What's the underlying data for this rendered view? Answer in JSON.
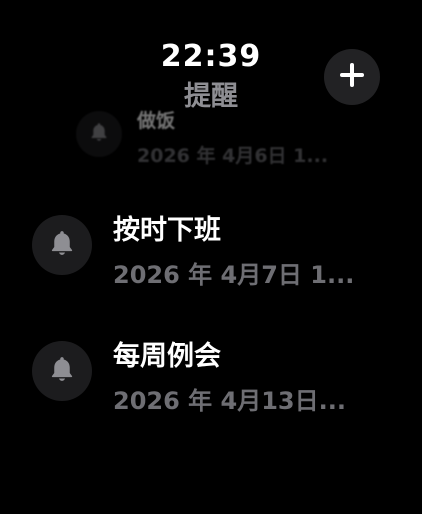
{
  "header": {
    "time": "22:39",
    "title": "提醒"
  },
  "add_button": {
    "icon": "plus-icon"
  },
  "reminders": [
    {
      "title": "做饭",
      "date": "2026 年 4月6日 1...",
      "icon": "bell-icon"
    },
    {
      "title": "按时下班",
      "date": "2026 年 4月7日 1...",
      "icon": "bell-icon"
    },
    {
      "title": "每周例会",
      "date": "2026 年 4月13日...",
      "icon": "bell-icon"
    }
  ],
  "colors": {
    "background": "#000000",
    "button_bg": "#222224",
    "icon_circle_bg": "#1c1c1e",
    "secondary_text": "#6e6e73",
    "title_gray": "#8e8e93"
  }
}
